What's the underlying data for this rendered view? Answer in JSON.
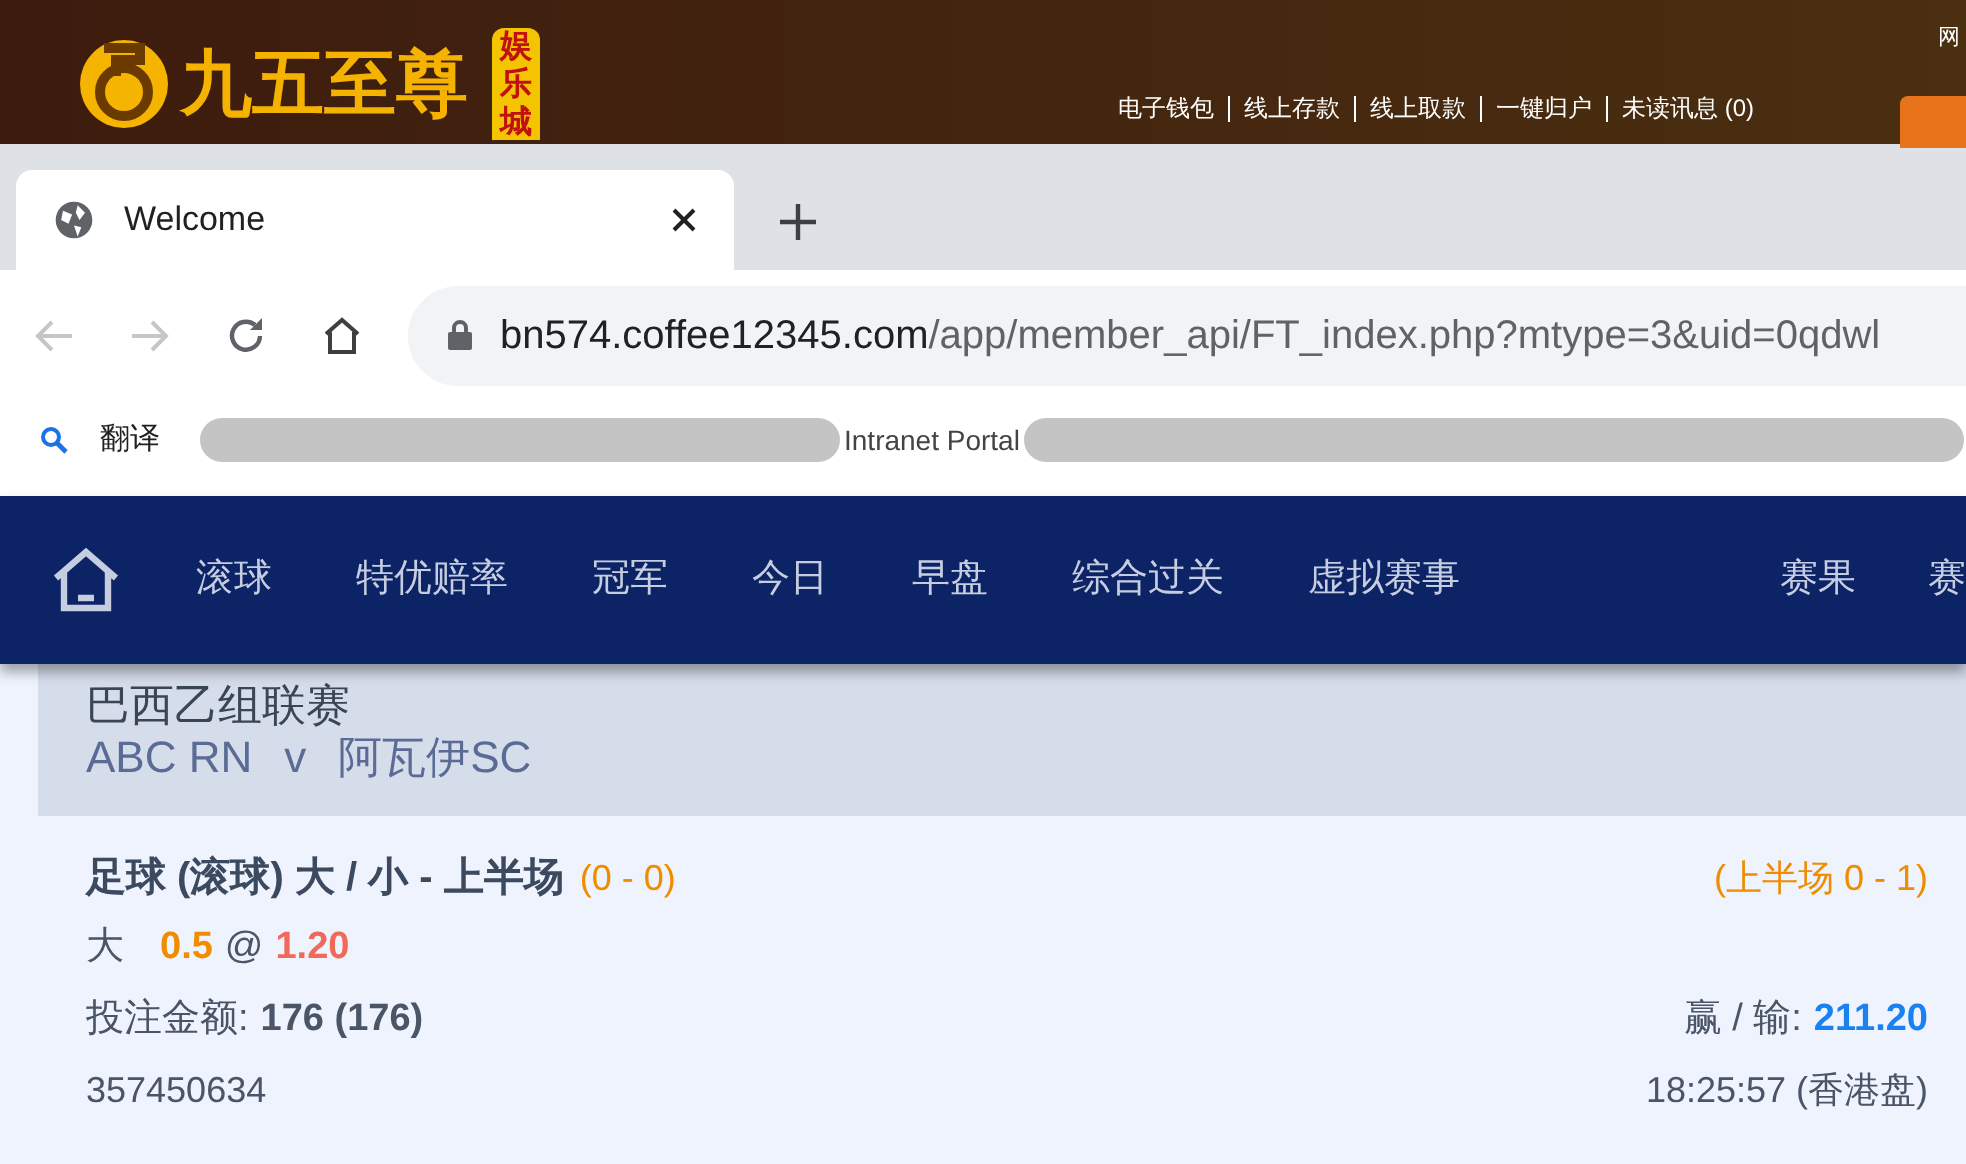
{
  "banner": {
    "logo_text": "九五至尊",
    "logo_badge": "娱乐城",
    "links": [
      "电子钱包",
      "线上存款",
      "线上取款",
      "一键归户",
      "未读讯息 (0)"
    ],
    "corner_text": "网"
  },
  "browser": {
    "tabs": [
      {
        "title": "Welcome",
        "selected": true
      }
    ],
    "address": {
      "host": "bn574.coffee12345.com",
      "path": "/app/member_api/FT_index.php?mtype=3&uid=0qdwl"
    },
    "bookmarks": [
      {
        "label": "翻译",
        "kind": "translate"
      },
      {
        "label": "Intranet Portal",
        "kind": "redacted"
      }
    ]
  },
  "nav": {
    "left_items": [
      "滚球",
      "特优赔率",
      "冠军",
      "今日",
      "早盘",
      "综合过关",
      "虚拟赛事"
    ],
    "right_items": [
      "赛果",
      "赛"
    ]
  },
  "bet": {
    "league": "巴西乙组联赛",
    "home": "ABC RN",
    "versus": "v",
    "away": "阿瓦伊SC",
    "title": "足球 (滚球) 大 / 小 - 上半场",
    "score": "(0 - 0)",
    "half_score": "(上半场 0 - 1)",
    "selection": "大",
    "line": "0.5",
    "at": "@",
    "odds": "1.20",
    "stake_label": "投注金额:",
    "stake": "176 (176)",
    "win_label": "赢 / 输:",
    "win": "211.20",
    "ticket": "357450634",
    "time": "18:25:57 (香港盘)"
  }
}
